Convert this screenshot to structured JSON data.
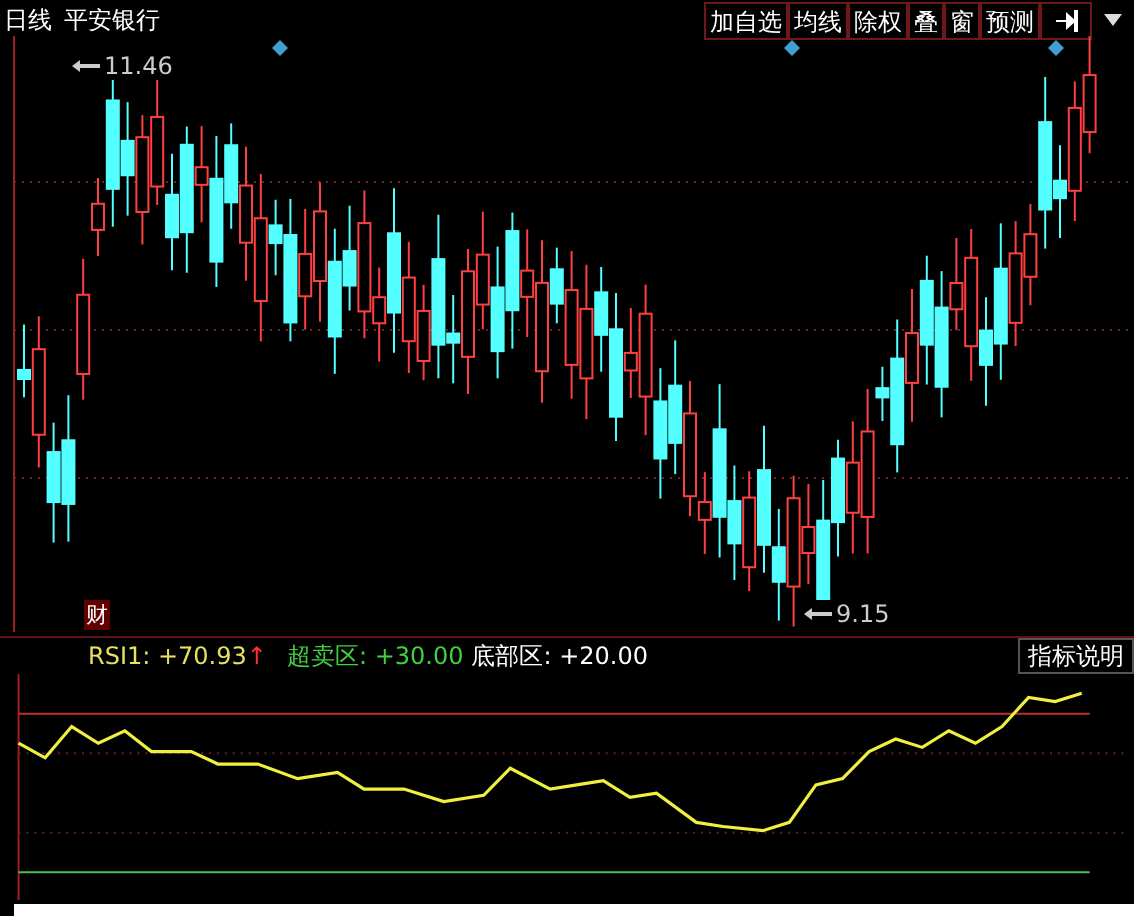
{
  "header": {
    "period": "日线",
    "stock_name": "平安银行"
  },
  "toolbar": [
    "加自选",
    "均线",
    "除权",
    "叠",
    "窗",
    "预测"
  ],
  "price_chart": {
    "high_label": "11.46",
    "low_label": "9.15",
    "news_badge": "财"
  },
  "indicator": {
    "values": [
      {
        "kind": "main",
        "label": "RSI1: +70.93",
        "arrow": "↑"
      },
      {
        "kind": "oversold",
        "label": "超卖区: +30.00"
      },
      {
        "kind": "bottom",
        "label": "底部区: +20.00"
      }
    ],
    "help_button": "指标说明"
  }
}
